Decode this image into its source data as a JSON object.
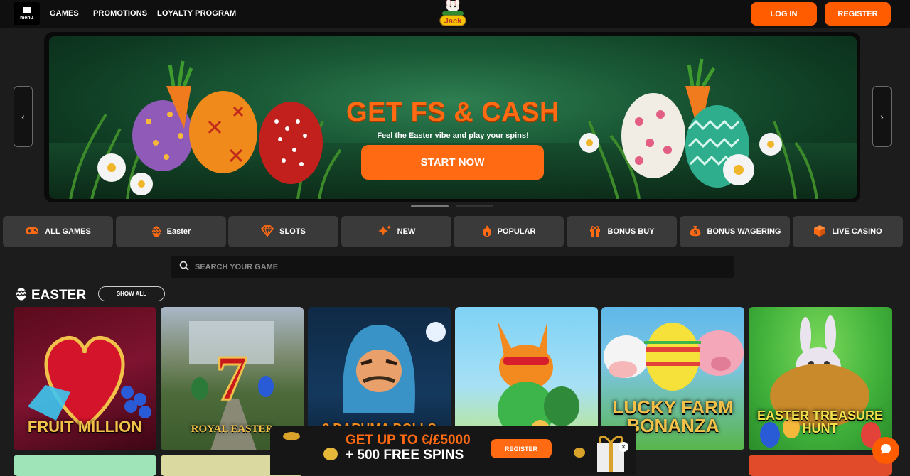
{
  "header": {
    "menu_label": "menu",
    "nav": [
      "GAMES",
      "PROMOTIONS",
      "LOYALTY PROGRAM"
    ],
    "logo_text": "Jack",
    "login_label": "LOG IN",
    "register_label": "REGISTER"
  },
  "hero": {
    "title": "GET FS & CASH",
    "subtitle": "Feel the Easter vibe and play your spins!",
    "cta_label": "START NOW",
    "prev_icon": "chevron-left-icon",
    "next_icon": "chevron-right-icon"
  },
  "categories": [
    {
      "label": "ALL GAMES",
      "icon": "gamepad-icon"
    },
    {
      "label": "Easter",
      "icon": "egg-icon"
    },
    {
      "label": "SLOTS",
      "icon": "diamond-icon"
    },
    {
      "label": "NEW",
      "icon": "sparkle-icon"
    },
    {
      "label": "POPULAR",
      "icon": "fire-icon"
    },
    {
      "label": "BONUS BUY",
      "icon": "gift-icon"
    },
    {
      "label": "BONUS WAGERING",
      "icon": "money-bag-icon"
    },
    {
      "label": "LIVE CASINO",
      "icon": "cube-icon"
    }
  ],
  "search": {
    "placeholder": "SEARCH YOUR GAME"
  },
  "section": {
    "title": "EASTER",
    "show_all_label": "SHOW ALL"
  },
  "games": [
    {
      "name": "FRUIT MILLION"
    },
    {
      "name": "ROYAL EASTER"
    },
    {
      "name": "3 DARUMA DOLLS"
    },
    {
      "name": ""
    },
    {
      "name": "LUCKY FARM BONANZA"
    },
    {
      "name": "EASTER TREASURE HUNT"
    }
  ],
  "promo": {
    "line1": "GET UP TO €/£5000",
    "line2": "+ 500 FREE SPINS",
    "register_label": "REGISTER"
  },
  "colors": {
    "accent": "#ff6a12",
    "background": "#1c1c1c",
    "category_bg": "#3a3a3a"
  }
}
